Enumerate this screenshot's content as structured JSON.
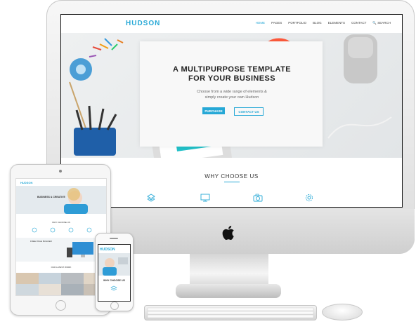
{
  "site": {
    "logo": "HUDSON",
    "nav": [
      "HOME",
      "PAGES",
      "PORTFOLIO",
      "BLOG",
      "ELEMENTS",
      "CONTACT"
    ],
    "search_label": "SEARCH",
    "hero_title_line1": "A MULTIPURPOSE TEMPLATE",
    "hero_title_line2": "FOR YOUR BUSINESS",
    "hero_sub_line1": "Choose from a wide range of elements &",
    "hero_sub_line2": "simply create your own Hudson",
    "purchase_label": "PURCHASE",
    "contact_label": "CONTACT US",
    "why_title": "WHY CHOOSE US",
    "feature_icons": [
      "layers-icon",
      "monitor-icon",
      "camera-icon",
      "gear-icon"
    ]
  },
  "ipad": {
    "logo": "HUDSON",
    "hero_title": "BUSINESS & CREATIVE",
    "why_title": "WHY CHOOSE US",
    "section_title": "FREE PAGE BUILDER",
    "projects_title": "OUR LATEST WORK"
  },
  "iphone": {
    "logo": "HUDSON",
    "why_title": "WHY CHOOSE US"
  },
  "colors": {
    "accent": "#26a8d6"
  }
}
